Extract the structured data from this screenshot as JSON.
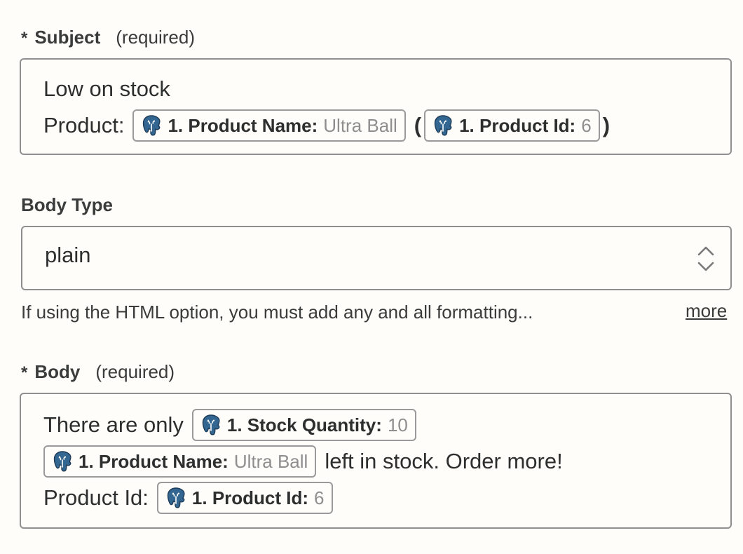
{
  "subject": {
    "required_star": "*",
    "label": "Subject",
    "required_text": "(required)",
    "line1": "Low on stock",
    "line2_prefix": "Product:",
    "pill1": {
      "key": "1. Product Name:",
      "value": "Ultra Ball"
    },
    "paren_open": "(",
    "pill2": {
      "key": "1. Product Id:",
      "value": "6"
    },
    "paren_close": ")"
  },
  "body_type": {
    "label": "Body Type",
    "value": "plain",
    "help_text": "If using the HTML option, you must add any and all formatting...",
    "more_label": "more"
  },
  "body": {
    "required_star": "*",
    "label": "Body",
    "required_text": "(required)",
    "line1_prefix": "There are only",
    "pill_stock": {
      "key": "1. Stock Quantity:",
      "value": "10"
    },
    "pill_name": {
      "key": "1. Product Name:",
      "value": "Ultra Ball"
    },
    "line2_suffix": "left in stock. Order more!",
    "line3_prefix": "Product Id:",
    "pill_id": {
      "key": "1. Product Id:",
      "value": "6"
    }
  },
  "colors": {
    "background": "#fffdf9",
    "border": "#8f8f8f",
    "postgres_blue": "#336791",
    "muted_value": "#8e8e8e"
  },
  "icons": {
    "pill_icon": "postgresql-elephant-icon",
    "select_icon": "chevron-up-down-icon"
  }
}
